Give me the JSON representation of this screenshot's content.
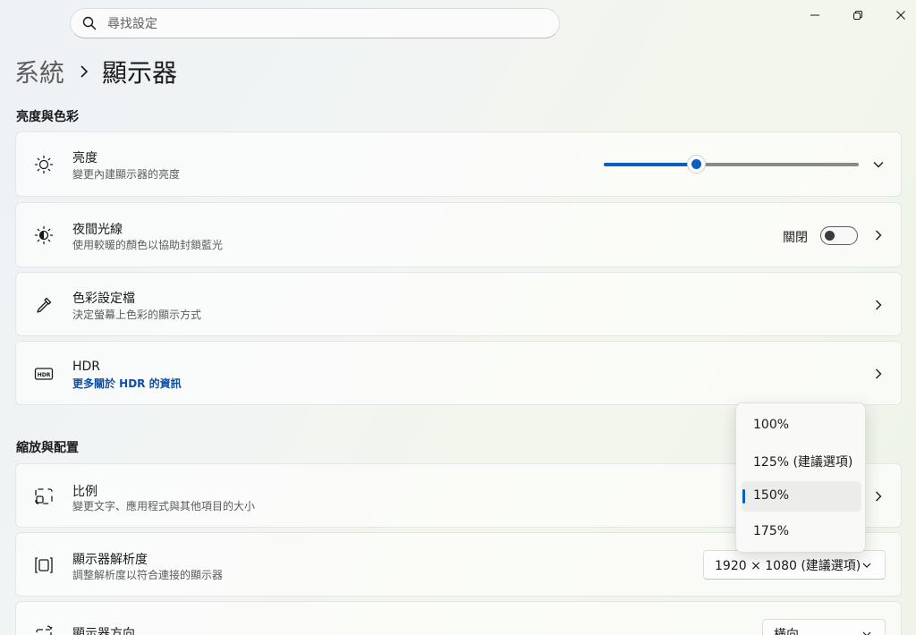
{
  "search": {
    "placeholder": "尋找設定"
  },
  "window_controls": [
    "minimize-icon",
    "restore-icon",
    "close-icon"
  ],
  "breadcrumb": {
    "parent": "系統",
    "separator_icon": "chevron-right-icon",
    "current": "顯示器"
  },
  "sections": {
    "brightness_color": "亮度與色彩",
    "scale_layout": "縮放與配置"
  },
  "brightness": {
    "title": "亮度",
    "subtitle": "變更內建顯示器的亮度",
    "level_percent": 36,
    "icon": "sun-icon"
  },
  "night_light": {
    "title": "夜間光線",
    "subtitle": "使用較暖的顏色以協助封鎖藍光",
    "toggle_label": "關閉",
    "toggle_on": false,
    "icon": "night-light-icon"
  },
  "color_profile": {
    "title": "色彩設定檔",
    "subtitle": "決定螢幕上色彩的顯示方式",
    "icon": "eyedropper-icon"
  },
  "hdr": {
    "title": "HDR",
    "link": "更多關於 HDR 的資訊",
    "icon": "hdr-icon"
  },
  "scale": {
    "title": "比例",
    "subtitle": "變更文字、應用程式與其他項目的大小",
    "icon": "scale-icon"
  },
  "resolution": {
    "title": "顯示器解析度",
    "subtitle": "調整解析度以符合連接的顯示器",
    "value": "1920 × 1080 (建議選項)",
    "icon": "resolution-icon"
  },
  "orientation": {
    "title": "顯示器方向",
    "value": "橫向",
    "icon": "orientation-icon"
  },
  "scale_menu": {
    "options": [
      "100%",
      "125% (建議選項)",
      "150%",
      "175%"
    ],
    "selected": "150%"
  },
  "colors": {
    "accent": "#0a5fc0",
    "link": "#0a4fa5"
  }
}
